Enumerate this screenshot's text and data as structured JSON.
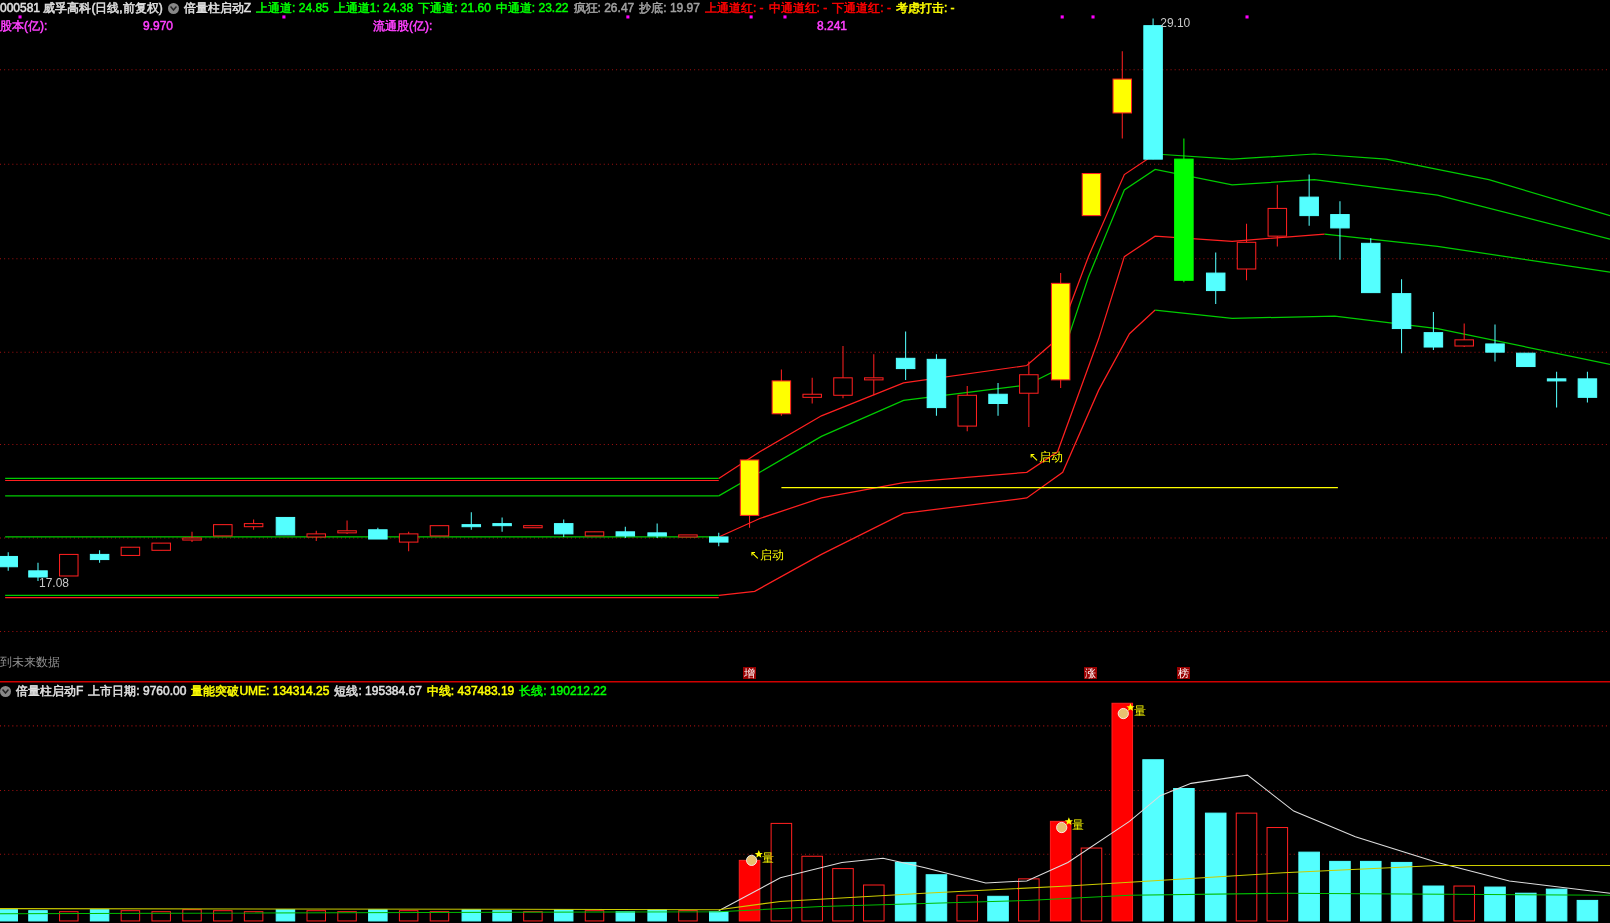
{
  "header": {
    "title": "000581 威孚高科(日线,前复权)",
    "indicator": "倍量柱启动Z",
    "items": [
      {
        "text": "上通道: 24.85",
        "color": "#00ff00"
      },
      {
        "text": "上通道1: 24.38",
        "color": "#00ff00"
      },
      {
        "text": "下通道: 21.60",
        "color": "#00ff00"
      },
      {
        "text": "中通道: 23.22",
        "color": "#00ff00"
      },
      {
        "text": "疯狂: 26.47",
        "color": "#a0a0a0"
      },
      {
        "text": "抄底: 19.97",
        "color": "#a0a0a0"
      },
      {
        "text": "上通道红: -",
        "color": "#ff0000"
      },
      {
        "text": "中通道红: -",
        "color": "#ff0000"
      },
      {
        "text": "下通道红: -",
        "color": "#ff0000"
      },
      {
        "text": "考虑打击: -",
        "color": "#ffff00"
      }
    ]
  },
  "info": [
    {
      "label": "股本(亿):",
      "value": "9.970"
    },
    {
      "label": "流通股(亿):",
      "value": "8.241"
    }
  ],
  "main_chart": {
    "price_labels": [
      "29.10",
      "17.08"
    ],
    "signals": [
      "↖启动",
      "↖启动"
    ],
    "note": "到未来数据",
    "tags": [
      "增",
      "涨",
      "榜"
    ]
  },
  "lower_panel": {
    "indicator": "倍量柱启动F",
    "items": [
      {
        "text": "上市日期: 9760.00",
        "color": "#e0e0e0"
      },
      {
        "text": "量能突破UME: 134314.25",
        "color": "#ffff00"
      },
      {
        "text": "短线: 195384.67",
        "color": "#e0e0e0"
      },
      {
        "text": "中线: 437483.19",
        "color": "#ffff00"
      },
      {
        "text": "长线: 190212.22",
        "color": "#00ff00"
      }
    ],
    "volume_signals": [
      "量",
      "量",
      "量"
    ]
  }
}
